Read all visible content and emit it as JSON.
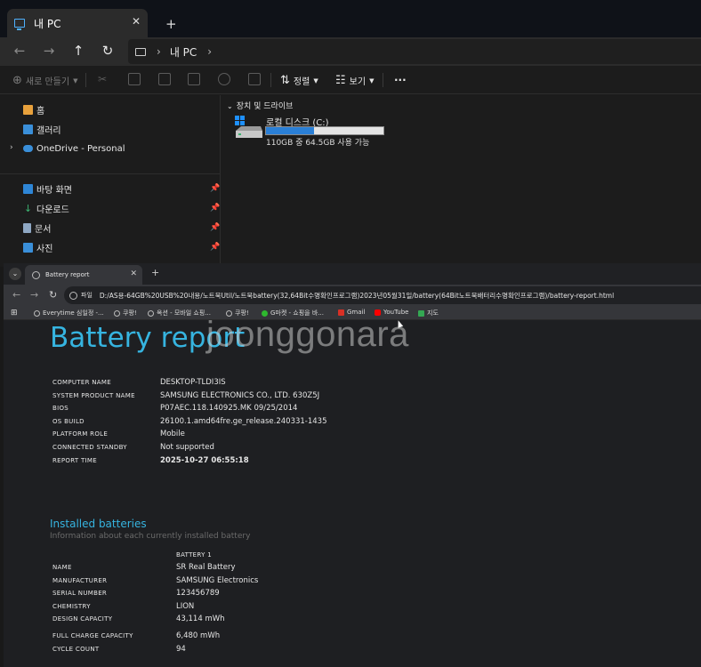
{
  "explorer": {
    "tab_title": "내 PC",
    "tab_close": "✕",
    "new_tab": "+",
    "nav": {
      "back": "←",
      "forward": "→",
      "up": "↑",
      "refresh": "↻"
    },
    "breadcrumb": {
      "separator": "›",
      "items": [
        "내 PC"
      ],
      "trailing_separator": "›"
    },
    "command_bar": {
      "new_label": "새로 만들기",
      "sort_label": "정렬",
      "view_label": "보기",
      "more_label": "···"
    },
    "sidebar": {
      "items": [
        {
          "label": "홈",
          "icon": "home-icon"
        },
        {
          "label": "갤러리",
          "icon": "gallery-icon"
        },
        {
          "label": "OneDrive - Personal",
          "icon": "onedrive-icon"
        },
        {
          "label": "바탕 화면",
          "icon": "desktop-folder-icon"
        },
        {
          "label": "다운로드",
          "icon": "download-icon"
        },
        {
          "label": "문서",
          "icon": "documents-icon"
        },
        {
          "label": "사진",
          "icon": "pictures-icon"
        }
      ]
    },
    "content": {
      "group_header": "장치 및 드라이브",
      "drive": {
        "name": "로컬 디스크 (C:)",
        "info": "110GB 중 64.5GB 사용 가능",
        "used_fraction": 0.41
      }
    },
    "colors": {
      "accent": "#4fb2ff",
      "drive_fill": "#2a7fd6"
    }
  },
  "browser": {
    "tab_title": "Battery report",
    "tab_close": "✕",
    "new_tab": "+",
    "address_chip": "파일",
    "url": "D:/AS용-64GB%20USB%20내용/노트북Util/노트북battery(32,64Bit수명확인프로그램)2023년05월31일/battery(64Bit노트북배터리수명확인프로그램)/battery-report.html",
    "bookmarks": [
      {
        "label": "Everytime 심일정 -...",
        "icon": "globe-icon"
      },
      {
        "label": "쿠팡!",
        "icon": "globe-icon"
      },
      {
        "label": "옥션 - 모바일 쇼핑...",
        "icon": "globe-icon"
      },
      {
        "label": "쿠팡!",
        "icon": "globe-icon"
      },
      {
        "label": "G마켓 - 쇼핑을 바...",
        "icon": "gmarket-icon"
      },
      {
        "label": "Gmail",
        "icon": "gmail-icon"
      },
      {
        "label": "YouTube",
        "icon": "youtube-icon"
      },
      {
        "label": "지도",
        "icon": "maps-icon"
      }
    ],
    "watermark": "joonggonara"
  },
  "report": {
    "title": "Battery report",
    "system_info": [
      {
        "label": "COMPUTER NAME",
        "value": "DESKTOP-TLDI3IS"
      },
      {
        "label": "SYSTEM PRODUCT NAME",
        "value": "SAMSUNG ELECTRONICS CO., LTD. 630Z5J"
      },
      {
        "label": "BIOS",
        "value": "P07AEC.118.140925.MK 09/25/2014"
      },
      {
        "label": "OS BUILD",
        "value": "26100.1.amd64fre.ge_release.240331-1435"
      },
      {
        "label": "PLATFORM ROLE",
        "value": "Mobile"
      },
      {
        "label": "CONNECTED STANDBY",
        "value": "Not supported"
      },
      {
        "label": "REPORT TIME",
        "value": "2025-10-27  06:55:18"
      }
    ],
    "installed_batteries": {
      "title": "Installed batteries",
      "subtitle": "Information about each currently installed battery",
      "column_header": "BATTERY 1",
      "rows": [
        {
          "label": "NAME",
          "value": "SR Real Battery"
        },
        {
          "label": "MANUFACTURER",
          "value": "SAMSUNG Electronics"
        },
        {
          "label": "SERIAL NUMBER",
          "value": "123456789"
        },
        {
          "label": "CHEMISTRY",
          "value": "LION"
        },
        {
          "label": "DESIGN CAPACITY",
          "value": "43,114 mWh"
        },
        {
          "label": "FULL CHARGE CAPACITY",
          "value": "6,480 mWh"
        },
        {
          "label": "CYCLE COUNT",
          "value": "94"
        }
      ]
    },
    "colors": {
      "heading": "#36b4e0"
    }
  }
}
